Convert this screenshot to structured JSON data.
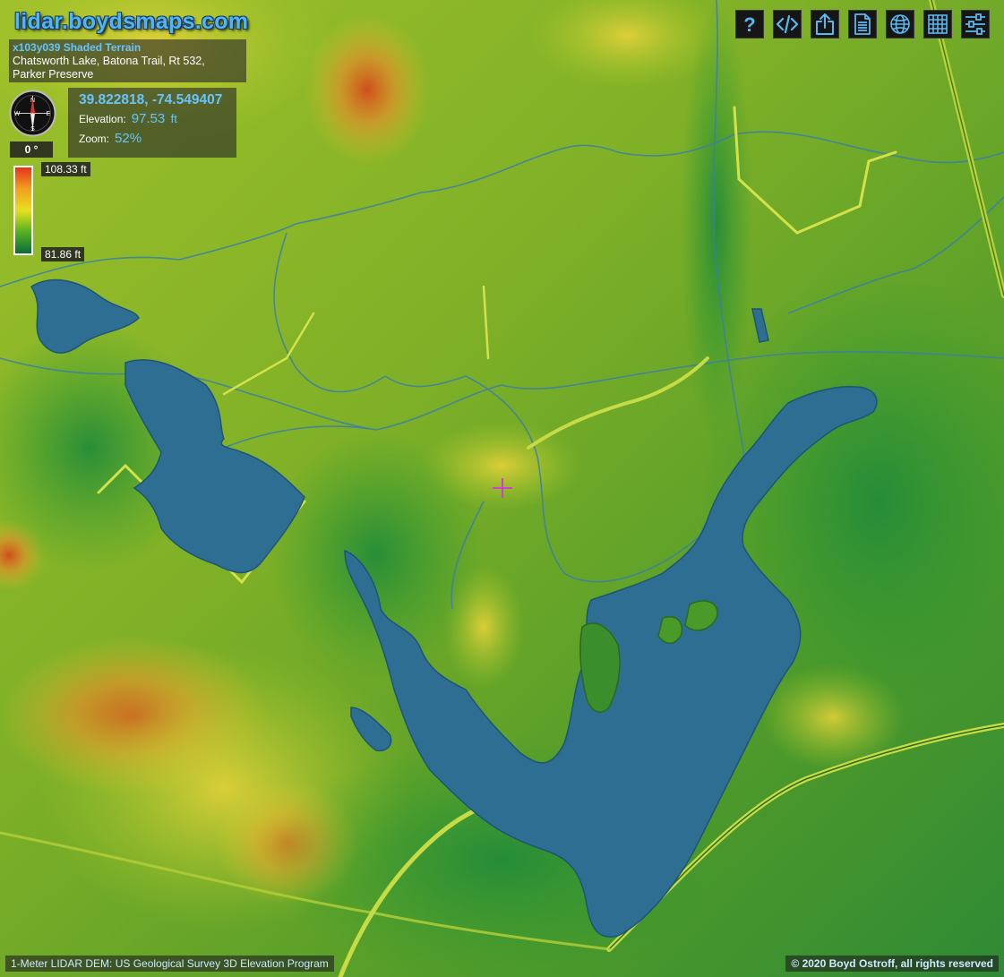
{
  "site": {
    "title": "lidar.boydsmaps.com"
  },
  "info": {
    "tile": "x103y039 Shaded Terrain",
    "places_line1": "Chatsworth Lake, Batona Trail, Rt 532,",
    "places_line2": "Parker Preserve"
  },
  "location": {
    "latlon": "39.822818, -74.549407",
    "elevation_label": "Elevation:",
    "elevation_value": "97.53",
    "elevation_unit": "ft",
    "zoom_label": "Zoom:",
    "zoom_value": "52%"
  },
  "compass": {
    "heading": "0 °",
    "n": "N",
    "e": "E",
    "s": "S",
    "w": "W"
  },
  "legend": {
    "max": "108.33 ft",
    "min": "81.86 ft",
    "colors": [
      "#e8331a",
      "#f0a020",
      "#e8e020",
      "#55b020",
      "#0b6b3a"
    ]
  },
  "toolbar": [
    "help-icon",
    "embed-code-icon",
    "share-icon",
    "document-icon",
    "globe-icon",
    "grid-icon",
    "settings-sliders-icon"
  ],
  "colors": {
    "water": "#2e6e92",
    "accent": "#4fb6ef",
    "crosshair": "#d040d0"
  },
  "footer": {
    "source": "1-Meter LIDAR DEM: US Geological Survey 3D Elevation Program",
    "copyright": "© 2020 Boyd Ostroff, all rights reserved"
  }
}
